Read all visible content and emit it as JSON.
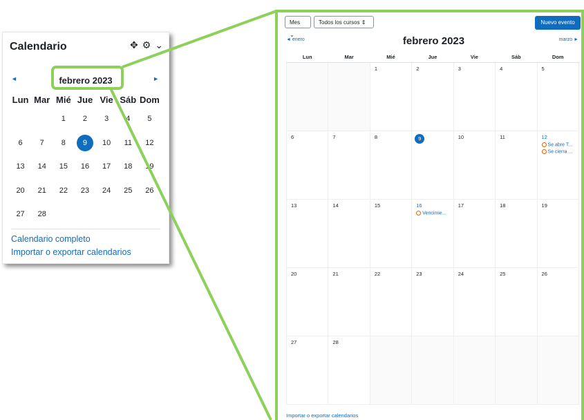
{
  "block": {
    "title": "Calendario",
    "controls": {
      "move_icon": "✥",
      "gear_icon": "⚙",
      "chevron_icon": "⌄"
    },
    "prev_arrow": "◄",
    "next_arrow": "►",
    "month": "febrero 2023",
    "weekdays": [
      "Lun",
      "Mar",
      "Mié",
      "Jue",
      "Vie",
      "Sáb",
      "Dom"
    ],
    "weeks": [
      [
        "",
        "",
        "1",
        "2",
        "3",
        "4",
        "5"
      ],
      [
        "6",
        "7",
        "8",
        "9",
        "10",
        "11",
        "12"
      ],
      [
        "13",
        "14",
        "15",
        "16",
        "17",
        "18",
        "19"
      ],
      [
        "20",
        "21",
        "22",
        "23",
        "24",
        "25",
        "26"
      ],
      [
        "27",
        "28",
        "",
        "",
        "",
        "",
        ""
      ]
    ],
    "today": "9",
    "link_full": "Calendario completo",
    "link_import": "Importar o exportar calendarios"
  },
  "panel": {
    "view_select": "Mes",
    "courses_select": "Todos los cursos",
    "new_event": "Nuevo evento",
    "month": "febrero 2023",
    "prev_month": "enero",
    "next_month": "marzo",
    "weekdays": [
      "Lun",
      "Mar",
      "Mié",
      "Jue",
      "Vie",
      "Sáb",
      "Dom"
    ],
    "weeks": [
      [
        {
          "d": ""
        },
        {
          "d": ""
        },
        {
          "d": "1"
        },
        {
          "d": "2"
        },
        {
          "d": "3"
        },
        {
          "d": "4"
        },
        {
          "d": "5"
        }
      ],
      [
        {
          "d": "6"
        },
        {
          "d": "7"
        },
        {
          "d": "8"
        },
        {
          "d": "9",
          "today": true
        },
        {
          "d": "10"
        },
        {
          "d": "11"
        },
        {
          "d": "12",
          "events": [
            "Se abre T...",
            "Se cierra ..."
          ]
        }
      ],
      [
        {
          "d": "13"
        },
        {
          "d": "14"
        },
        {
          "d": "15"
        },
        {
          "d": "16",
          "events": [
            "Vencimie..."
          ]
        },
        {
          "d": "17"
        },
        {
          "d": "18"
        },
        {
          "d": "19"
        }
      ],
      [
        {
          "d": "20"
        },
        {
          "d": "21"
        },
        {
          "d": "22"
        },
        {
          "d": "23"
        },
        {
          "d": "24"
        },
        {
          "d": "25"
        },
        {
          "d": "26"
        }
      ],
      [
        {
          "d": "27"
        },
        {
          "d": "28"
        },
        {
          "d": ""
        },
        {
          "d": ""
        },
        {
          "d": ""
        },
        {
          "d": ""
        },
        {
          "d": ""
        }
      ]
    ],
    "footer_link": "Importar o exportar calendarios"
  },
  "colors": {
    "accent": "#0f6cbf",
    "highlight": "#8dd05a",
    "event_icon": "#e36209"
  }
}
